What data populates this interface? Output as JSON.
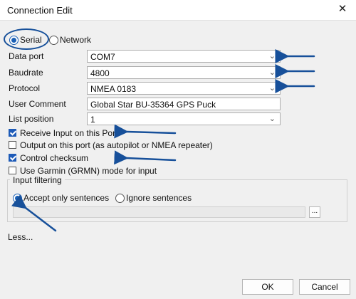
{
  "window": {
    "title": "Connection Edit",
    "close_icon": "close-icon"
  },
  "connection_type": {
    "serial_label": "Serial",
    "network_label": "Network",
    "selected": "serial"
  },
  "fields": {
    "data_port": {
      "label": "Data port",
      "value": "COM7"
    },
    "baudrate": {
      "label": "Baudrate",
      "value": "4800"
    },
    "protocol": {
      "label": "Protocol",
      "value": "NMEA 0183"
    },
    "user_comment": {
      "label": "User Comment",
      "value": "Global Star BU-35364 GPS Puck"
    },
    "list_position": {
      "label": "List position",
      "value": "1"
    }
  },
  "options": [
    {
      "label": "Receive Input on this Port",
      "checked": true
    },
    {
      "label": "Output on this port (as autopilot or NMEA repeater)",
      "checked": false
    },
    {
      "label": "Control checksum",
      "checked": true
    },
    {
      "label": "Use Garmin (GRMN) mode for input",
      "checked": false
    }
  ],
  "input_filtering": {
    "title": "Input filtering",
    "accept_label": "Accept only sentences",
    "ignore_label": "Ignore sentences",
    "selected": "accept",
    "sentences_value": "",
    "browse_label": "..."
  },
  "less_link": "Less...",
  "buttons": {
    "ok": "OK",
    "cancel": "Cancel"
  },
  "colors": {
    "accent": "#1a5fb4",
    "annotation": "#17509a"
  }
}
